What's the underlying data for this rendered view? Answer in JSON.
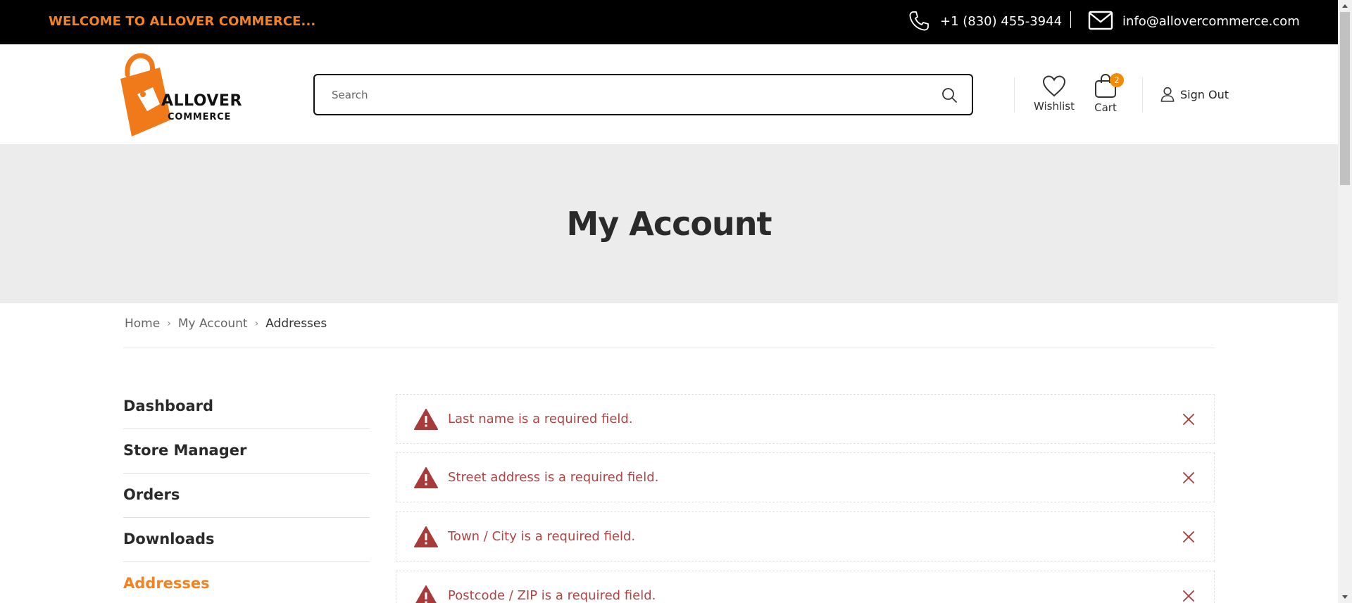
{
  "topbar": {
    "welcome": "WELCOME TO ALLOVER COMMERCE...",
    "phone": "+1 (830) 455-3944",
    "email": "info@allovercommerce.com"
  },
  "header": {
    "logo_line1": "ALLOVER",
    "logo_line2": "COMMERCE",
    "search_placeholder": "Search",
    "wishlist_label": "Wishlist",
    "cart_label": "Cart",
    "cart_count": "2",
    "signout_label": "Sign Out"
  },
  "hero": {
    "title": "My Account"
  },
  "breadcrumb": {
    "items": [
      "Home",
      "My Account",
      "Addresses"
    ]
  },
  "sidebar": {
    "items": [
      {
        "label": "Dashboard"
      },
      {
        "label": "Store Manager"
      },
      {
        "label": "Orders"
      },
      {
        "label": "Downloads"
      },
      {
        "label": "Addresses"
      }
    ]
  },
  "notices": [
    {
      "message": "Last name is a required field."
    },
    {
      "message": "Street address is a required field."
    },
    {
      "message": "Town / City is a required field."
    },
    {
      "message": "Postcode / ZIP is a required field."
    }
  ],
  "colors": {
    "accent": "#f58220",
    "error_text": "#b04343",
    "error_icon": "#a83a3a",
    "topbar_bg": "#000000",
    "hero_bg": "#ececec"
  }
}
